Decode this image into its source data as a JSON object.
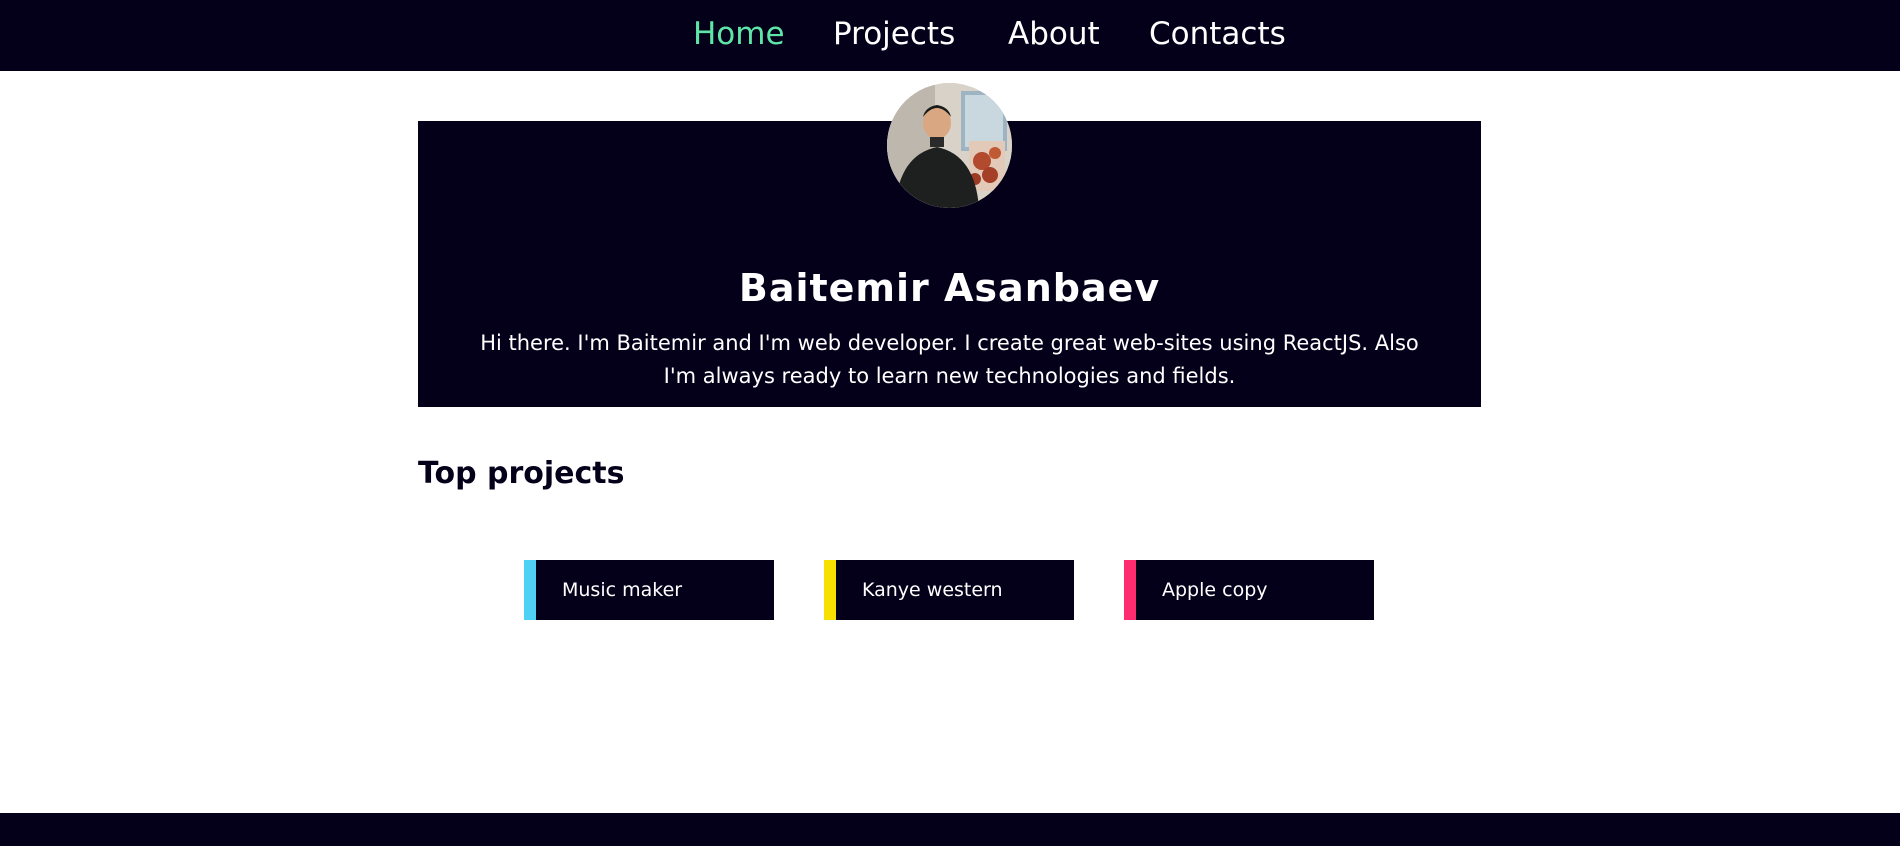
{
  "nav": {
    "items": [
      {
        "label": "Home",
        "active": true
      },
      {
        "label": "Projects",
        "active": false
      },
      {
        "label": "About",
        "active": false
      },
      {
        "label": "Contacts",
        "active": false
      }
    ]
  },
  "hero": {
    "avatar_icon": "profile-photo",
    "name": "Baitemir Asanbaev",
    "bio": "Hi there. I'm Baitemir and I'm web developer. I create great web-sites using ReactJS. Also I'm always ready to learn new technologies and fields."
  },
  "projects": {
    "title": "Top projects",
    "items": [
      {
        "label": "Music maker",
        "accent_color": "#4fd1f5"
      },
      {
        "label": "Kanye western",
        "accent_color": "#f7df00"
      },
      {
        "label": "Apple copy",
        "accent_color": "#ff2d6f"
      }
    ]
  },
  "colors": {
    "dark": "#05001a",
    "active_link": "#5ee6a8",
    "background": "#ffffff",
    "text_light": "#ffffff"
  }
}
